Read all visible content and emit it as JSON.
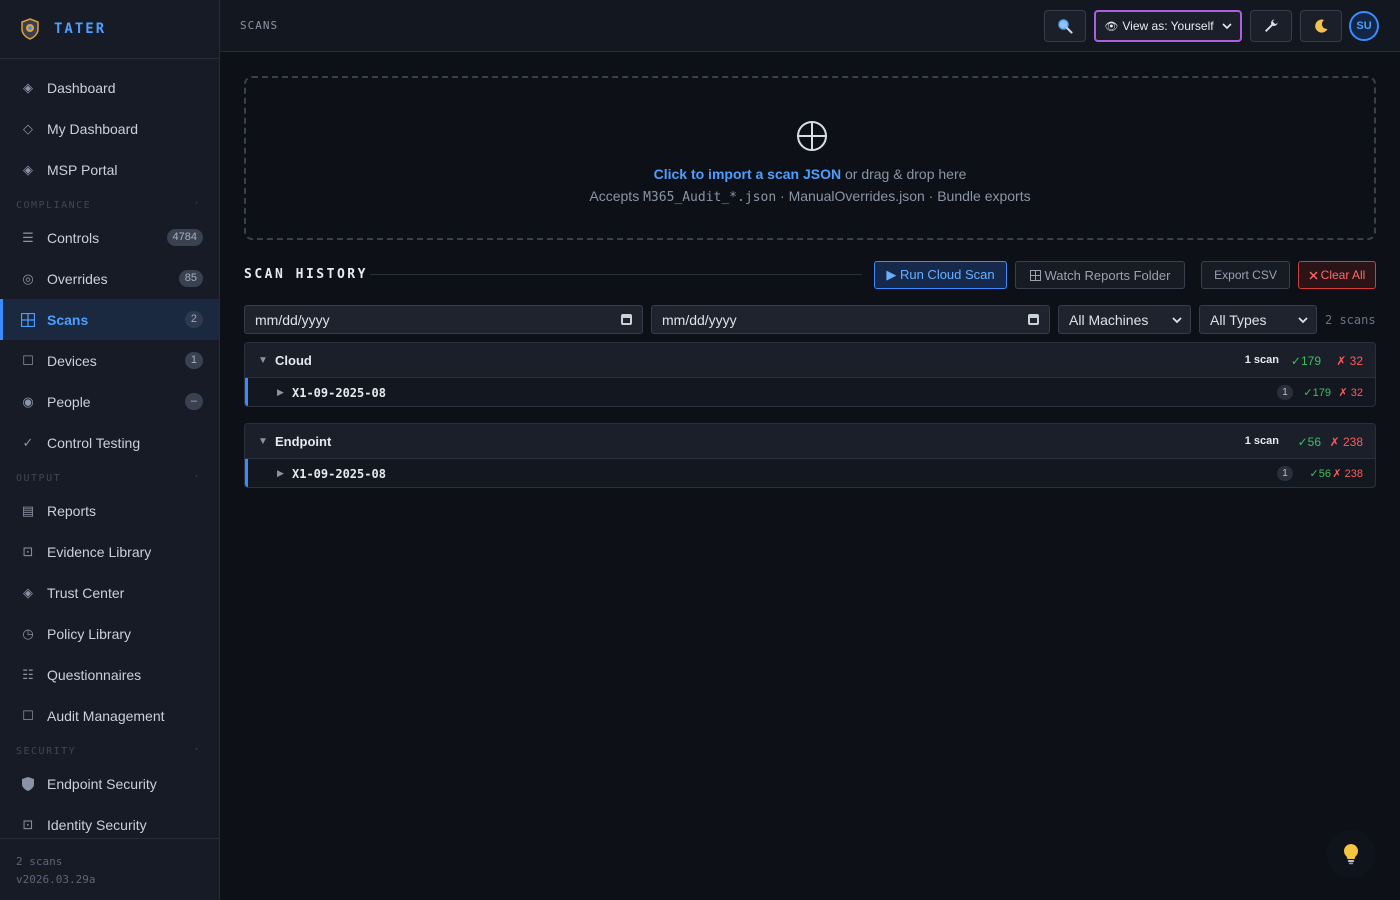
{
  "brand": {
    "name": "TATER"
  },
  "sidebar": {
    "top_items": [
      {
        "label": "Dashboard"
      },
      {
        "label": "My Dashboard"
      },
      {
        "label": "MSP Portal"
      }
    ],
    "compliance": {
      "header": "COMPLIANCE",
      "items": [
        {
          "label": "Controls",
          "badge": "4784"
        },
        {
          "label": "Overrides",
          "badge": "85"
        },
        {
          "label": "Scans",
          "badge": "2"
        },
        {
          "label": "Devices",
          "badge": "1"
        },
        {
          "label": "People",
          "badge": "–"
        },
        {
          "label": "Control Testing"
        }
      ]
    },
    "output": {
      "header": "OUTPUT",
      "items": [
        {
          "label": "Reports"
        },
        {
          "label": "Evidence Library"
        },
        {
          "label": "Trust Center"
        },
        {
          "label": "Policy Library"
        },
        {
          "label": "Questionnaires"
        },
        {
          "label": "Audit Management"
        }
      ]
    },
    "security": {
      "header": "SECURITY",
      "items": [
        {
          "label": "Endpoint Security"
        },
        {
          "label": "Identity Security"
        }
      ]
    },
    "footer": {
      "scan_count": "2 scans",
      "version": "v2026.03.29a"
    }
  },
  "topbar": {
    "title": "SCANS",
    "view_as": {
      "selected": "View as: Yourself"
    },
    "avatar": "SU"
  },
  "dropzone": {
    "link": "Click to import a scan JSON",
    "rest": " or drag & drop here",
    "accepts_prefix": "Accepts ",
    "accepts_mono": "M365_Audit_*.json",
    "accepts_suffix": " · ManualOverrides.json · Bundle exports"
  },
  "history": {
    "title": "SCAN HISTORY",
    "buttons": {
      "run": "▶ Run Cloud Scan",
      "watch": "Watch Reports Folder",
      "export": "Export CSV",
      "clear": "Clear All"
    },
    "filters": {
      "date_from": "mm/dd/yyyy",
      "date_to": "mm/dd/yyyy",
      "machines": "All Machines",
      "types": "All Types",
      "count": "2 scans"
    },
    "groups": [
      {
        "name": "Cloud",
        "count": "1 scan",
        "pass": "✓179",
        "fail": "✗ 32",
        "rows": [
          {
            "name": "X1-09-2025-08",
            "badge": "1",
            "pass": "✓179",
            "fail": "✗ 32"
          }
        ]
      },
      {
        "name": "Endpoint",
        "count": "1 scan",
        "pass": "✓56",
        "fail": "✗ 238",
        "rows": [
          {
            "name": "X1-09-2025-08",
            "badge": "1",
            "pass": "✓56",
            "fail": "✗ 238"
          }
        ]
      }
    ]
  },
  "colors": {
    "accent": "#3b8bff",
    "pass": "#3fbf5f",
    "fail": "#ff5a5a",
    "view_as_border": "#b05de0"
  },
  "icons": {
    "search": "search-icon",
    "wrench": "wrench-icon",
    "theme": "moon-icon",
    "tip": "lightbulb-icon"
  }
}
